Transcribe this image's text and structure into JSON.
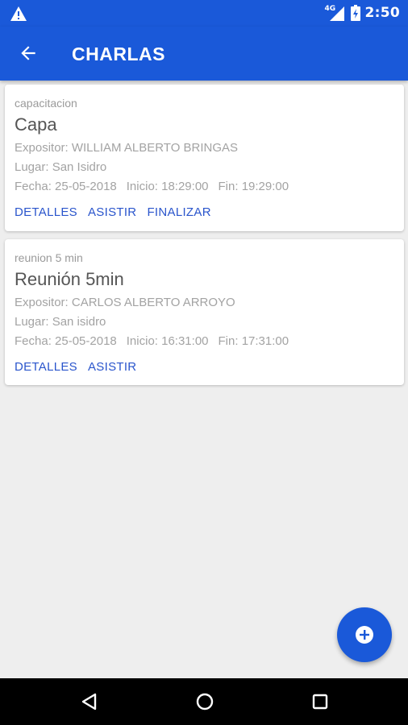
{
  "status_bar": {
    "network": "4G",
    "time": "2:50",
    "icons": [
      "warning-icon",
      "signal-icon",
      "battery-icon"
    ]
  },
  "app_bar": {
    "title": "CHARLAS",
    "back_icon": "arrow-back-icon"
  },
  "cards": [
    {
      "category": "capacitacion",
      "name": "Capa",
      "expositor": "Expositor: WILLIAM ALBERTO BRINGAS",
      "lugar": "Lugar: San Isidro",
      "fecha": "Fecha: 25-05-2018",
      "inicio": "Inicio: 18:29:00",
      "fin": "Fin: 19:29:00",
      "actions": [
        "DETALLES",
        "ASISTIR",
        "FINALIZAR"
      ]
    },
    {
      "category": "reunion 5 min",
      "name": "Reunión 5min",
      "expositor": "Expositor: CARLOS ALBERTO ARROYO",
      "lugar": "Lugar: San isidro",
      "fecha": "Fecha: 25-05-2018",
      "inicio": "Inicio: 16:31:00",
      "fin": "Fin: 17:31:00",
      "actions": [
        "DETALLES",
        "ASISTIR"
      ]
    }
  ],
  "fab": {
    "icon": "add-circle-icon"
  },
  "nav_bar": {
    "icons": [
      "back-triangle-icon",
      "home-circle-icon",
      "recents-square-icon"
    ]
  },
  "colors": {
    "primary": "#1a59d9",
    "accent_text": "#2a55cc",
    "background": "#eeeeee"
  }
}
